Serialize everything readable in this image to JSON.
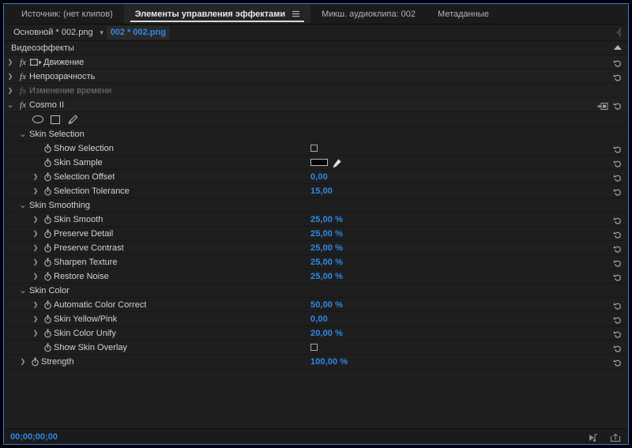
{
  "panel_tabs": [
    {
      "label": "Источник: (нет клипов)",
      "active": false,
      "menu": false
    },
    {
      "label": "Элементы управления эффектами",
      "active": true,
      "menu": true
    },
    {
      "label": "Микш. аудиоклипа: 002",
      "active": false,
      "menu": false
    },
    {
      "label": "Метаданные",
      "active": false,
      "menu": false
    }
  ],
  "clip_bar": {
    "sequence": "Основной * 002.png",
    "separator": "chevron-right-icon",
    "clip": "002 * 002.png"
  },
  "effects_header": {
    "title": "Видеоэффекты",
    "collapse_icon": "triangle-up-icon"
  },
  "rows": [
    {
      "type": "effect",
      "indent": 0,
      "twirl": "closed",
      "fx": true,
      "dim": false,
      "icon": "motion-icon",
      "label": "Движение",
      "value": null,
      "value_type": "none",
      "reset": true,
      "composite": false
    },
    {
      "type": "effect",
      "indent": 0,
      "twirl": "closed",
      "fx": true,
      "dim": false,
      "icon": null,
      "label": "Непрозрачность",
      "value": null,
      "value_type": "none",
      "reset": true,
      "composite": false
    },
    {
      "type": "effect",
      "indent": 0,
      "twirl": "closed",
      "fx": true,
      "dim": true,
      "icon": null,
      "label": "Изменение времени",
      "value": null,
      "value_type": "none",
      "reset": false,
      "composite": false
    },
    {
      "type": "effect",
      "indent": 0,
      "twirl": "open",
      "fx": true,
      "dim": false,
      "icon": null,
      "label": "Cosmo II",
      "value": null,
      "value_type": "none",
      "reset": true,
      "composite": true
    },
    {
      "type": "masktools",
      "indent": 1,
      "twirl": "none",
      "fx": false,
      "dim": false,
      "icon": null,
      "label": "",
      "value": null,
      "value_type": "none",
      "reset": false,
      "composite": false
    },
    {
      "type": "group",
      "indent": 1,
      "twirl": "open",
      "fx": false,
      "dim": false,
      "icon": null,
      "label": "Skin Selection",
      "value": null,
      "value_type": "none",
      "reset": false,
      "composite": false
    },
    {
      "type": "param",
      "indent": 2,
      "twirl": "none",
      "fx": false,
      "dim": false,
      "icon": "stopwatch",
      "label": "Show Selection",
      "value": null,
      "value_type": "checkbox",
      "reset": true,
      "composite": false
    },
    {
      "type": "param",
      "indent": 2,
      "twirl": "none",
      "fx": false,
      "dim": false,
      "icon": "stopwatch",
      "label": "Skin Sample",
      "value": null,
      "value_type": "swatch",
      "reset": true,
      "composite": false
    },
    {
      "type": "param",
      "indent": 2,
      "twirl": "closed",
      "fx": false,
      "dim": false,
      "icon": "stopwatch",
      "label": "Selection Offset",
      "value": "0,00",
      "value_type": "number",
      "reset": true,
      "composite": false
    },
    {
      "type": "param",
      "indent": 2,
      "twirl": "closed",
      "fx": false,
      "dim": false,
      "icon": "stopwatch",
      "label": "Selection Tolerance",
      "value": "15,00",
      "value_type": "number",
      "reset": true,
      "composite": false
    },
    {
      "type": "group",
      "indent": 1,
      "twirl": "open",
      "fx": false,
      "dim": false,
      "icon": null,
      "label": "Skin Smoothing",
      "value": null,
      "value_type": "none",
      "reset": false,
      "composite": false
    },
    {
      "type": "param",
      "indent": 2,
      "twirl": "closed",
      "fx": false,
      "dim": false,
      "icon": "stopwatch",
      "label": "Skin Smooth",
      "value": "25,00 %",
      "value_type": "number",
      "reset": true,
      "composite": false
    },
    {
      "type": "param",
      "indent": 2,
      "twirl": "closed",
      "fx": false,
      "dim": false,
      "icon": "stopwatch",
      "label": "Preserve Detail",
      "value": "25,00 %",
      "value_type": "number",
      "reset": true,
      "composite": false
    },
    {
      "type": "param",
      "indent": 2,
      "twirl": "closed",
      "fx": false,
      "dim": false,
      "icon": "stopwatch",
      "label": "Preserve Contrast",
      "value": "25,00 %",
      "value_type": "number",
      "reset": true,
      "composite": false
    },
    {
      "type": "param",
      "indent": 2,
      "twirl": "closed",
      "fx": false,
      "dim": false,
      "icon": "stopwatch",
      "label": "Sharpen Texture",
      "value": "25,00 %",
      "value_type": "number",
      "reset": true,
      "composite": false
    },
    {
      "type": "param",
      "indent": 2,
      "twirl": "closed",
      "fx": false,
      "dim": false,
      "icon": "stopwatch",
      "label": "Restore Noise",
      "value": "25,00 %",
      "value_type": "number",
      "reset": true,
      "composite": false
    },
    {
      "type": "group",
      "indent": 1,
      "twirl": "open",
      "fx": false,
      "dim": false,
      "icon": null,
      "label": "Skin Color",
      "value": null,
      "value_type": "none",
      "reset": false,
      "composite": false
    },
    {
      "type": "param",
      "indent": 2,
      "twirl": "closed",
      "fx": false,
      "dim": false,
      "icon": "stopwatch",
      "label": "Automatic Color Correct",
      "value": "50,00 %",
      "value_type": "number",
      "reset": true,
      "composite": false
    },
    {
      "type": "param",
      "indent": 2,
      "twirl": "closed",
      "fx": false,
      "dim": false,
      "icon": "stopwatch",
      "label": "Skin Yellow/Pink",
      "value": "0,00",
      "value_type": "number",
      "reset": true,
      "composite": false
    },
    {
      "type": "param",
      "indent": 2,
      "twirl": "closed",
      "fx": false,
      "dim": false,
      "icon": "stopwatch",
      "label": "Skin Color Unify",
      "value": "20,00 %",
      "value_type": "number",
      "reset": true,
      "composite": false
    },
    {
      "type": "param",
      "indent": 2,
      "twirl": "none",
      "fx": false,
      "dim": false,
      "icon": "stopwatch",
      "label": "Show Skin Overlay",
      "value": null,
      "value_type": "checkbox",
      "reset": true,
      "composite": false
    },
    {
      "type": "param",
      "indent": 1,
      "twirl": "closed",
      "fx": false,
      "dim": false,
      "icon": "stopwatch",
      "label": "Strength",
      "value": "100,00 %",
      "value_type": "number",
      "reset": true,
      "composite": false
    }
  ],
  "mask_tools": [
    {
      "name": "ellipse-mask-tool"
    },
    {
      "name": "rectangle-mask-tool"
    },
    {
      "name": "pen-mask-tool"
    }
  ],
  "bottom_bar": {
    "timecode": "00;00;00;00",
    "icons": [
      {
        "name": "play-keyframe-icon"
      },
      {
        "name": "export-frame-icon"
      }
    ]
  },
  "colors": {
    "accent_blue": "#2f89e5",
    "panel_bg": "#1e1e1e",
    "tab_bg": "#1b1b1b",
    "border_focus": "#2b7de0",
    "text": "#d2d2d2",
    "text_dim": "#777777"
  }
}
